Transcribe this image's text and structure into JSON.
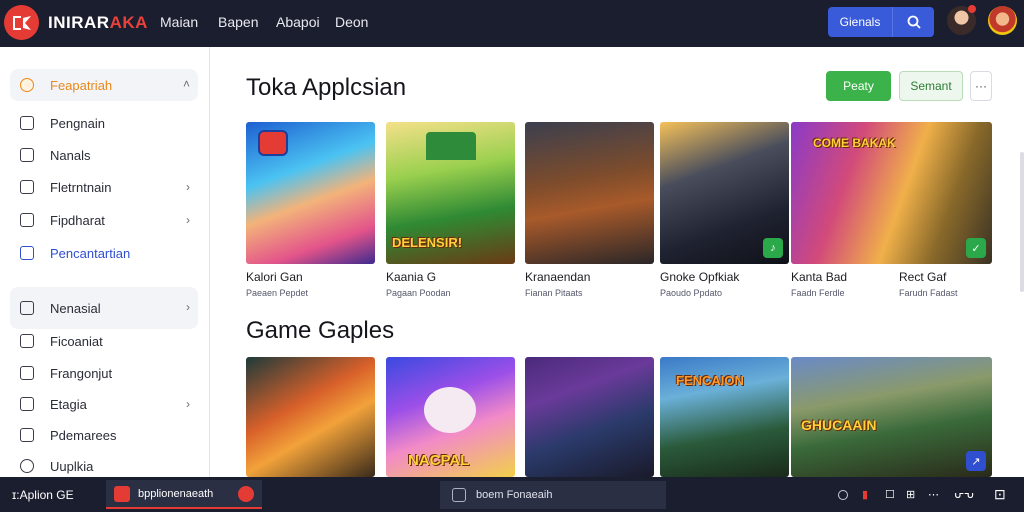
{
  "header": {
    "brand_main": "INIRAR",
    "brand_accent": "AKA",
    "nav": [
      "Maian",
      "Bapen",
      "Abapoi",
      "Deon"
    ],
    "search_label": "Gienals",
    "search_icon": "search-icon",
    "colors": {
      "bar": "#1b1e2e",
      "accent": "#e53b35",
      "search": "#3a5bd9"
    }
  },
  "sidebar": {
    "items": [
      {
        "label": "Feapatriah",
        "icon": "gamepad-icon",
        "chevron": "˄",
        "active": true
      },
      {
        "label": "Pengnain",
        "icon": "box-icon",
        "chevron": ""
      },
      {
        "label": "Nanals",
        "icon": "bookmark-icon",
        "chevron": ""
      },
      {
        "label": "Fletrntnain",
        "icon": "check-square-icon",
        "chevron": "›"
      },
      {
        "label": "Fipdharat",
        "icon": "edit-icon",
        "chevron": "›"
      },
      {
        "label": "Pencantartian",
        "icon": "badge-check-icon",
        "chevron": ""
      },
      {
        "label": "Nenasial",
        "icon": "gear-icon",
        "chevron": "›"
      },
      {
        "label": "Ficoaniat",
        "icon": "tag-icon",
        "chevron": ""
      },
      {
        "label": "Frangonjut",
        "icon": "calendar-icon",
        "chevron": ""
      },
      {
        "label": "Etagia",
        "icon": "flag-icon",
        "chevron": "›"
      },
      {
        "label": "Pdemarees",
        "icon": "shield-icon",
        "chevron": ""
      },
      {
        "label": "Uuplkia",
        "icon": "power-icon",
        "chevron": ""
      }
    ]
  },
  "main": {
    "section1_title": "Toka Applcsian",
    "buttons": {
      "primary": "Peaty",
      "secondary": "Semant",
      "more": "···"
    },
    "row1": [
      {
        "name": "Kalori Gan",
        "sub": "Paeaen Pepdet",
        "overlay": "",
        "badge": ""
      },
      {
        "name": "Kaania G",
        "sub": "Pagaan Poodan",
        "overlay": "DELENSIR!",
        "badge": ""
      },
      {
        "name": "Kranaendan",
        "sub": "Fianan Pitaats",
        "overlay": "",
        "badge": ""
      },
      {
        "name": "Gnoke Opfkiak",
        "sub": "Paoudo Ppdato",
        "overlay": "",
        "badge": "♪"
      },
      {
        "name": "Kanta Bad",
        "sub": "Faadn Ferdle",
        "overlay": "COME BAKAK",
        "badge": "✓"
      },
      {
        "name": "Rect Gaf",
        "sub": "Farudn Fadast",
        "overlay": "",
        "badge": ""
      }
    ],
    "section2_title": "Game Gaples",
    "row2": [
      {
        "overlay": "",
        "badge": ""
      },
      {
        "overlay": "NACPAL",
        "badge": ""
      },
      {
        "overlay": "",
        "badge": ""
      },
      {
        "overlay": "FENCAION",
        "badge": ""
      },
      {
        "overlay": "GHUCAAIN",
        "badge": "↗"
      }
    ]
  },
  "taskbar": {
    "start_label": "ɪ:Aplion GE",
    "app_label": "bpplionenaeath",
    "search_label": "boem Fonaeaih",
    "tray": [
      "☐",
      "▮",
      "⊞",
      "⋯",
      "ᕂᕃ",
      "⊡"
    ]
  }
}
